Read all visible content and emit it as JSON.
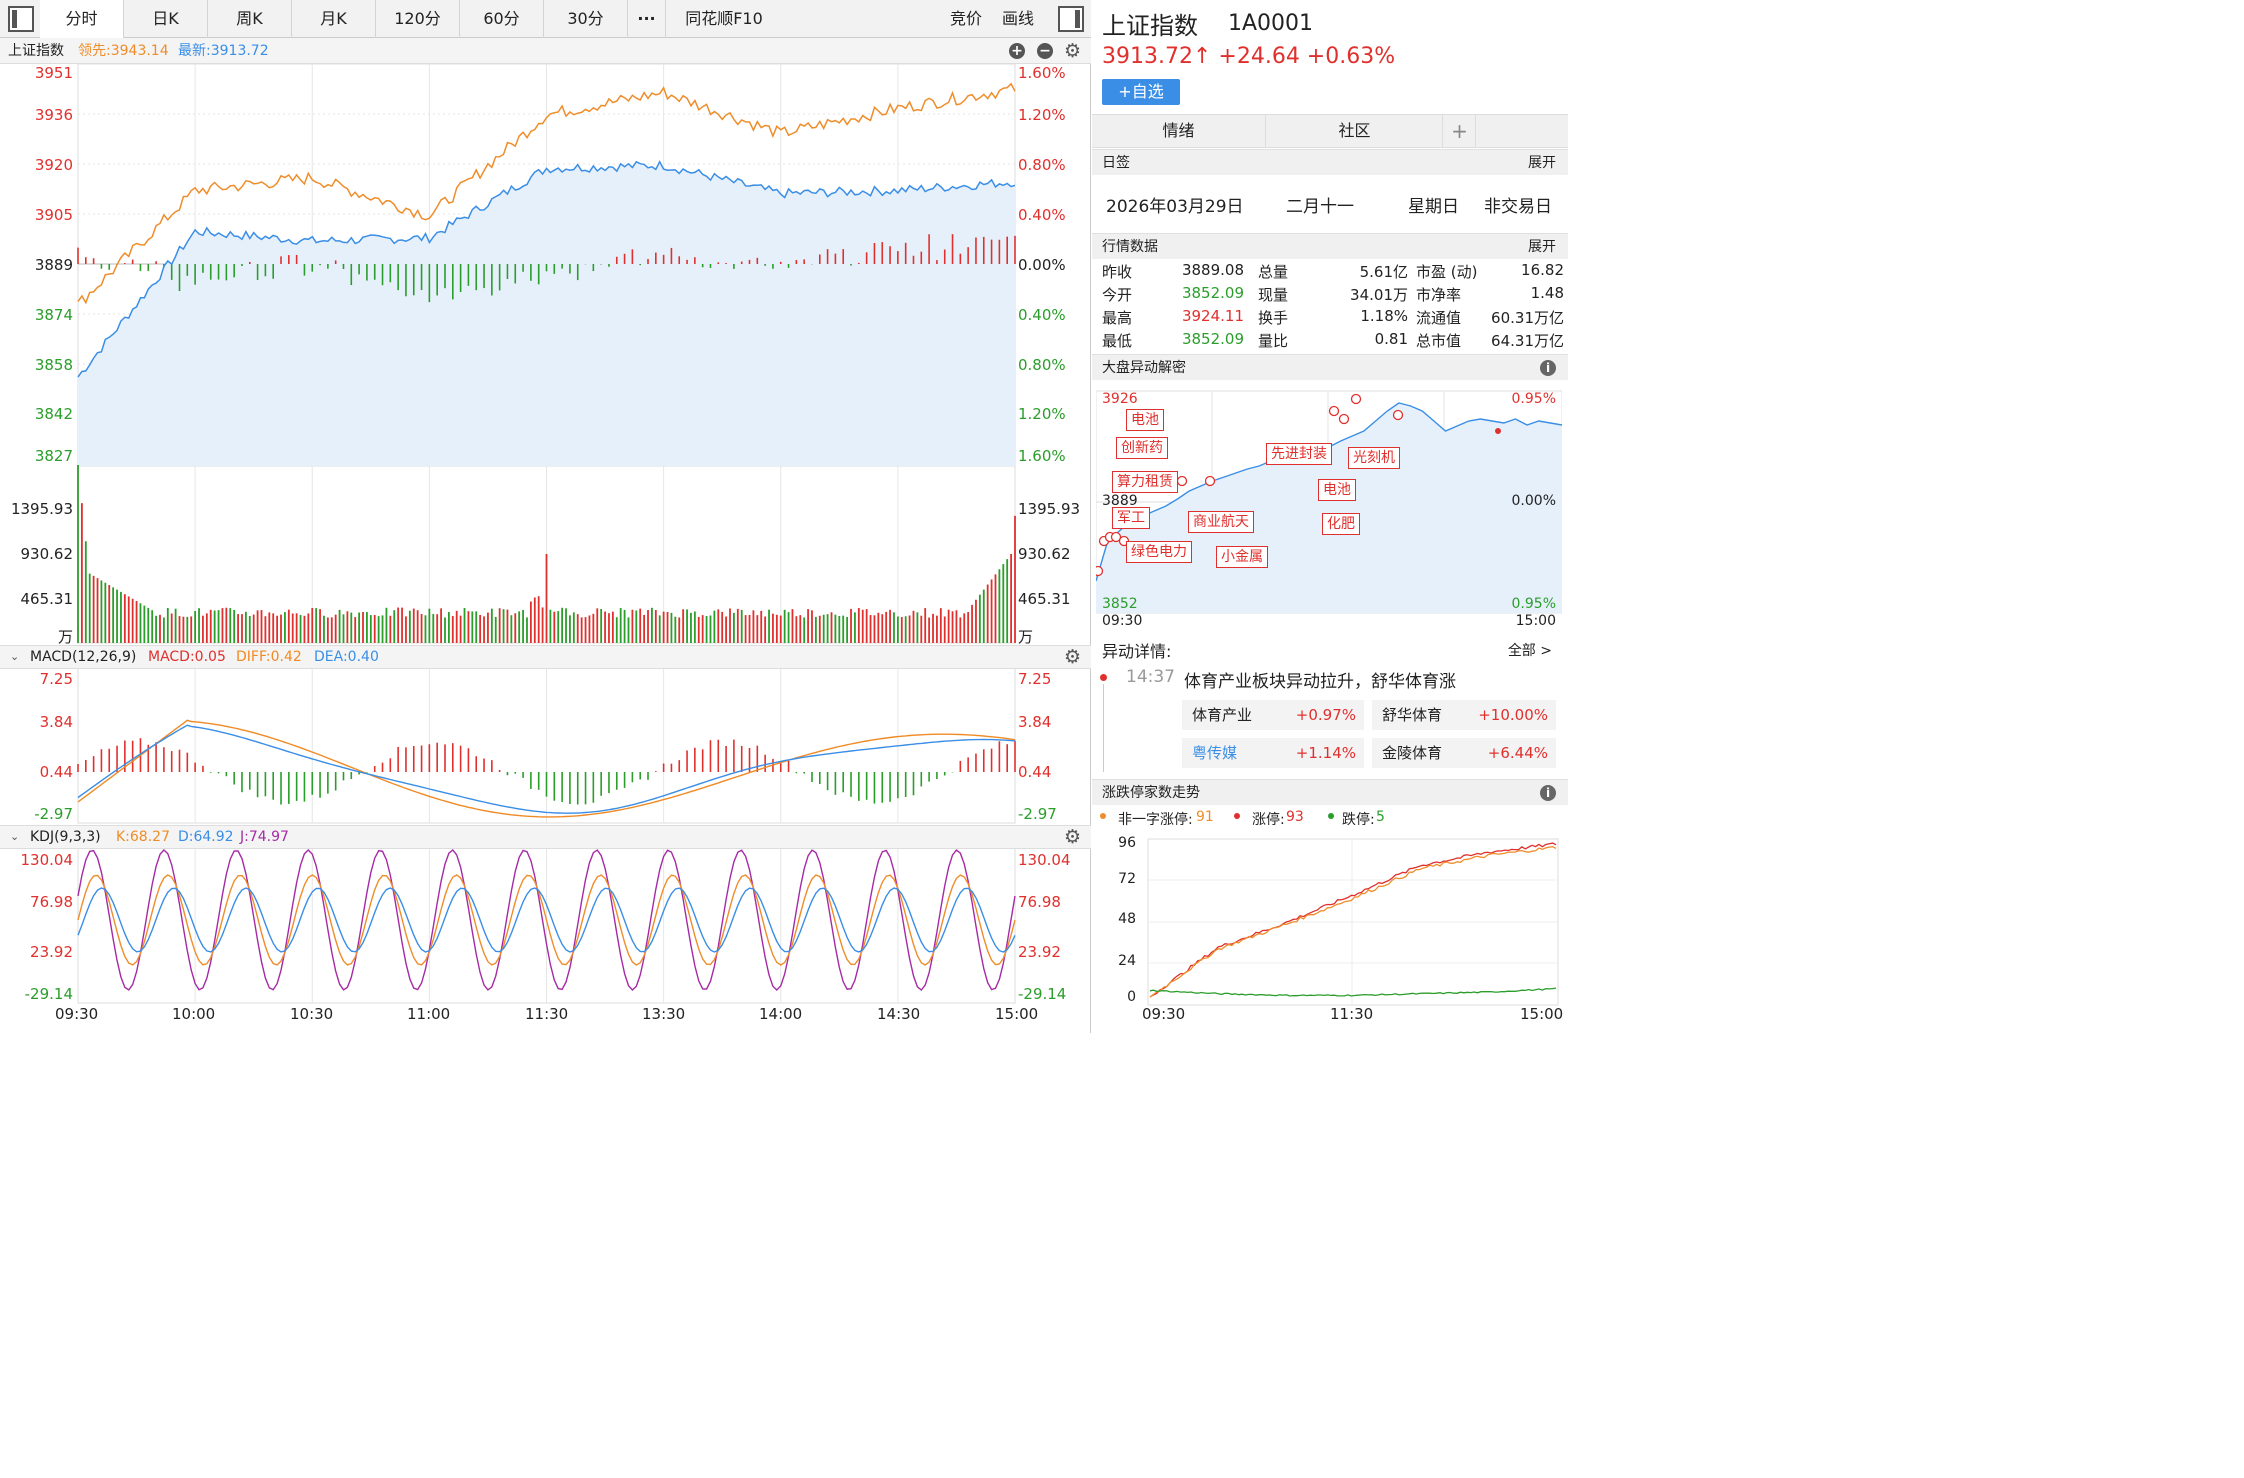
{
  "toolbar": {
    "tabs": [
      "分时",
      "日K",
      "周K",
      "月K",
      "120分",
      "60分",
      "30分",
      "···",
      "同花顺F10"
    ],
    "right_items": [
      "竞价",
      "画线"
    ]
  },
  "main_header": {
    "name": "上证指数",
    "lead_label": "领先:3943.14",
    "latest_label": "最新:3913.72"
  },
  "macd_header": {
    "name": "MACD(12,26,9)",
    "macd": "MACD:0.05",
    "diff": "DIFF:0.42",
    "dea": "DEA:0.40"
  },
  "kdj_header": {
    "name": "KDJ(9,3,3)",
    "k": "K:68.27",
    "d": "D:64.92",
    "j": "J:74.97"
  },
  "price_axis": {
    "left": [
      "3951",
      "3936",
      "3920",
      "3905",
      "3889",
      "3874",
      "3858",
      "3842",
      "3827"
    ],
    "right": [
      "1.60%",
      "1.20%",
      "0.80%",
      "0.40%",
      "0.00%",
      "0.40%",
      "0.80%",
      "1.20%",
      "1.60%"
    ]
  },
  "volume_axis": {
    "labels": [
      "1395.93",
      "930.62",
      "465.31",
      "万"
    ]
  },
  "macd_axis": {
    "labels": [
      "7.25",
      "3.84",
      "0.44",
      "-2.97"
    ]
  },
  "kdj_axis": {
    "labels": [
      "130.04",
      "76.98",
      "23.92",
      "-29.14"
    ]
  },
  "time_axis": [
    "09:30",
    "10:00",
    "10:30",
    "11:00",
    "11:30",
    "13:30",
    "14:00",
    "14:30",
    "15:00"
  ],
  "colors": {
    "up": "#e0302d",
    "down": "#2a9d2a",
    "price": "#3a8ee6",
    "lead": "#ee8d2a",
    "macd_diff": "#f08a24",
    "macd_dea": "#3a8ee6",
    "kdj_k": "#ee8d2a",
    "kdj_d": "#3a8ee6",
    "kdj_j": "#a52aa5",
    "button": "#3a8ee6"
  },
  "chart_data": [
    {
      "type": "line",
      "name_ref": "intraday-price",
      "x": [
        "09:30",
        "10:00",
        "10:30",
        "11:00",
        "11:30",
        "13:30",
        "14:00",
        "14:30",
        "15:00"
      ],
      "series": [
        {
          "values": [
            3852,
            3898,
            3895,
            3896,
            3918,
            3919,
            3910,
            3911,
            3913.72
          ]
        },
        {
          "values": [
            3875,
            3911,
            3915,
            3903,
            3935,
            3942,
            3929,
            3937,
            3943.14
          ]
        }
      ],
      "ylim": [
        3827,
        3951
      ]
    },
    {
      "type": "bar",
      "name_ref": "volume",
      "ylim": [
        0,
        1400
      ]
    },
    {
      "type": "line",
      "name_ref": "macd",
      "ylim": [
        -2.97,
        7.25
      ]
    },
    {
      "type": "line",
      "name_ref": "kdj",
      "ylim": [
        -29.14,
        130.04
      ]
    }
  ],
  "quote": {
    "title": "上证指数",
    "code": "1A0001",
    "price_line": "3913.72↑ +24.64 +0.63%",
    "watch_button": "+自选",
    "tabs": [
      "情绪",
      "社区"
    ],
    "add_tab": "+"
  },
  "daily": {
    "header": "日签",
    "expand": "展开",
    "date": "2026年03月29日",
    "lunar": "二月十一",
    "weekday": "星期日",
    "status": "非交易日"
  },
  "market": {
    "header": "行情数据",
    "expand": "展开",
    "rows": [
      [
        "昨收",
        "3889.08",
        "总量",
        "5.61亿",
        "市盈 (动)",
        "16.82"
      ],
      [
        "今开",
        "3852.09",
        "现量",
        "34.01万",
        "市净率",
        "1.48"
      ],
      [
        "最高",
        "3924.11",
        "换手",
        "1.18%",
        "流通值",
        "60.31万亿"
      ],
      [
        "最低",
        "3852.09",
        "量比",
        "0.81",
        "总市值",
        "64.31万亿"
      ]
    ]
  },
  "anomaly": {
    "header": "大盘异动解密",
    "y_top": "3926",
    "y_mid": "3889",
    "y_bot": "3852",
    "pct_top": "0.95%",
    "pct_mid": "0.00%",
    "pct_bot": "0.95%",
    "t_start": "09:30",
    "t_end": "15:00",
    "tags": [
      "电池",
      "创新药",
      "算力租赁",
      "军工",
      "绿色电力",
      "商业航天",
      "小金属",
      "先进封装",
      "电池",
      "化肥",
      "光刻机"
    ]
  },
  "detail": {
    "header": "异动详情:",
    "all": "全部 >",
    "time": "14:37",
    "text": "体育产业板块异动拉升，舒华体育涨",
    "items": [
      [
        "体育产业",
        "+0.97%"
      ],
      [
        "舒华体育",
        "+10.00%"
      ],
      [
        "粤传媒",
        "+1.14%"
      ],
      [
        "金陵体育",
        "+6.44%"
      ]
    ]
  },
  "limit": {
    "header": "涨跌停家数走势",
    "legend": [
      "非一字涨停:",
      "91",
      "涨停:",
      "93",
      "跌停:",
      "5"
    ],
    "y": [
      "96",
      "72",
      "48",
      "24",
      "0"
    ],
    "x": [
      "09:30",
      "11:30",
      "15:00"
    ],
    "chart_data": {
      "type": "line",
      "series": [
        {
          "values": [
            0,
            30,
            45,
            62,
            80,
            88,
            93
          ]
        },
        {
          "values": [
            0,
            29,
            44,
            60,
            78,
            86,
            91
          ]
        },
        {
          "values": [
            4,
            2,
            1,
            1,
            2,
            3,
            5
          ]
        }
      ],
      "ylim": [
        0,
        96
      ]
    }
  }
}
